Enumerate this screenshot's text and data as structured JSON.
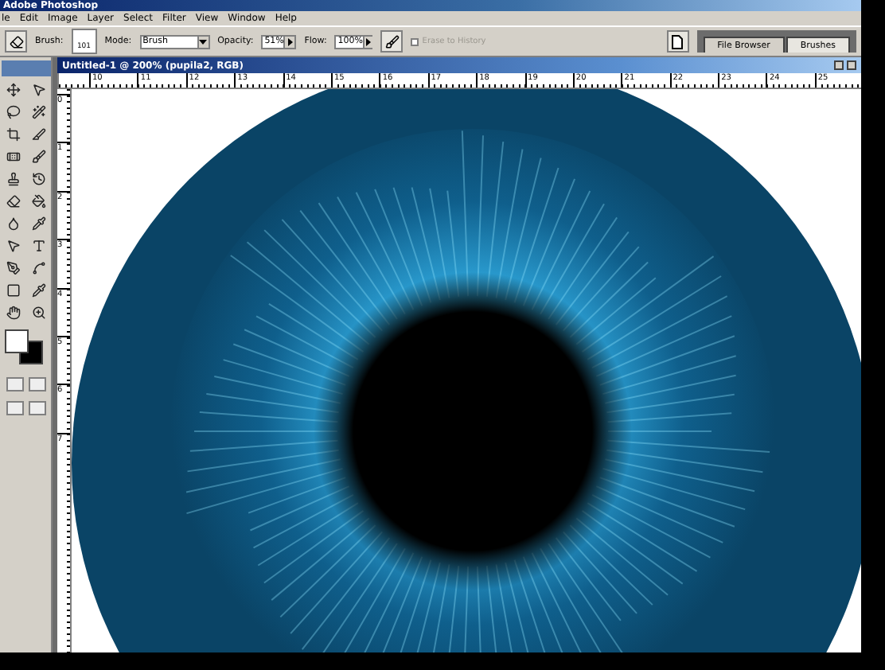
{
  "app_title": "Adobe Photoshop",
  "menu": [
    "le",
    "Edit",
    "Image",
    "Layer",
    "Select",
    "Filter",
    "View",
    "Window",
    "Help"
  ],
  "options": {
    "brush_label": "Brush:",
    "brush_size": "101",
    "mode_label": "Mode:",
    "mode_value": "Brush",
    "opacity_label": "Opacity:",
    "opacity_value": "51%",
    "flow_label": "Flow:",
    "flow_value": "100%",
    "erase_to_history": {
      "label": "Erase to History",
      "checked": false,
      "disabled": true
    }
  },
  "palette_tabs": [
    {
      "label": "File Browser",
      "selected": false
    },
    {
      "label": "Brushes",
      "selected": true
    }
  ],
  "document": {
    "title": "Untitled-1 @ 200% (pupila2, RGB)",
    "ruler_h": [
      "10",
      "11",
      "12",
      "13",
      "14",
      "15",
      "16",
      "17",
      "18",
      "19",
      "20",
      "21",
      "22",
      "23",
      "24",
      "25"
    ],
    "ruler_v": [
      "0",
      "1",
      "2",
      "3",
      "4",
      "5",
      "6",
      "7"
    ]
  }
}
